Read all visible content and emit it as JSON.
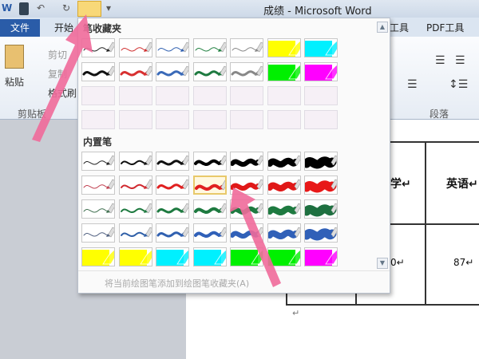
{
  "window": {
    "title": "成绩 - Microsoft Word"
  },
  "quick_access": {
    "word_icon": "W",
    "save": "save-icon",
    "undo": "undo-icon",
    "redo": "redo-icon",
    "pen": "pen-icon",
    "customize": "▾"
  },
  "tabs": {
    "file": "文件",
    "home": "开始",
    "tools": "工具",
    "pdf": "PDF工具"
  },
  "ribbon": {
    "paste": "粘贴",
    "cut": "剪切",
    "copy": "复制",
    "format_painter": "格式刷",
    "clipboard_group": "剪贴板",
    "paragraph_group": "段落"
  },
  "document": {
    "header_math": "学↵",
    "header_english": "英语↵",
    "val_math": "0↵",
    "val_english": "87↵",
    "para_mark": "↵"
  },
  "pen_panel": {
    "favorites_title": "笔收藏夹",
    "builtin_title": "内置笔",
    "footer": "将当前绘图笔添加到绘图笔收藏夹(A)",
    "favorites": [
      [
        {
          "c": "#222222",
          "w": 1
        },
        {
          "c": "#d03030",
          "w": 1
        },
        {
          "c": "#3060b0",
          "w": 1
        },
        {
          "c": "#208040",
          "w": 1
        },
        {
          "c": "#888888",
          "w": 1
        },
        {
          "c": "#ffff00",
          "h": true
        },
        {
          "c": "#00f0ff",
          "h": true
        }
      ],
      [
        {
          "c": "#111111",
          "w": 3
        },
        {
          "c": "#d83030",
          "w": 3
        },
        {
          "c": "#3a6ab8",
          "w": 3
        },
        {
          "c": "#1e7a40",
          "w": 3
        },
        {
          "c": "#888888",
          "w": 3
        },
        {
          "c": "#00f000",
          "h": true
        },
        {
          "c": "#ff00ff",
          "h": true
        }
      ],
      [
        null,
        null,
        null,
        null,
        null,
        null,
        null
      ],
      [
        null,
        null,
        null,
        null,
        null,
        null,
        null
      ]
    ],
    "builtin": [
      [
        {
          "c": "#222222",
          "w": 1
        },
        {
          "c": "#111111",
          "w": 2
        },
        {
          "c": "#111111",
          "w": 3
        },
        {
          "c": "#000000",
          "w": 4
        },
        {
          "c": "#000000",
          "w": 6
        },
        {
          "c": "#000000",
          "w": 8
        },
        {
          "c": "#000000",
          "w": 11
        }
      ],
      [
        {
          "c": "#c04050",
          "w": 1
        },
        {
          "c": "#d02a30",
          "w": 2
        },
        {
          "c": "#e02020",
          "w": 3
        },
        {
          "c": "#e02020",
          "w": 4
        },
        {
          "c": "#e01818",
          "w": 6
        },
        {
          "c": "#e01818",
          "w": 8
        },
        {
          "c": "#e81818",
          "w": 11
        }
      ],
      [
        {
          "c": "#407050",
          "w": 1
        },
        {
          "c": "#1e7a40",
          "w": 2
        },
        {
          "c": "#1e7a40",
          "w": 3
        },
        {
          "c": "#1e7a40",
          "w": 4
        },
        {
          "c": "#1e7a40",
          "w": 6
        },
        {
          "c": "#1e7a40",
          "w": 8
        },
        {
          "c": "#1e7040",
          "w": 11
        }
      ],
      [
        {
          "c": "#506080",
          "w": 1
        },
        {
          "c": "#3060a8",
          "w": 2
        },
        {
          "c": "#3060b0",
          "w": 3
        },
        {
          "c": "#3060b8",
          "w": 4
        },
        {
          "c": "#3060b8",
          "w": 6
        },
        {
          "c": "#3060b8",
          "w": 8
        },
        {
          "c": "#3060b8",
          "w": 11
        }
      ],
      [
        {
          "c": "#ffff00",
          "h": true
        },
        {
          "c": "#ffff00",
          "h": true
        },
        {
          "c": "#00f0ff",
          "h": true
        },
        {
          "c": "#00f0ff",
          "h": true
        },
        {
          "c": "#00f000",
          "h": true
        },
        {
          "c": "#00f000",
          "h": true
        },
        {
          "c": "#ff00ff",
          "h": true
        }
      ]
    ],
    "selected": {
      "row": 1,
      "col": 3
    }
  },
  "colors": {
    "arrow": "#f06a9a",
    "file_tab": "#2a5ca8"
  }
}
